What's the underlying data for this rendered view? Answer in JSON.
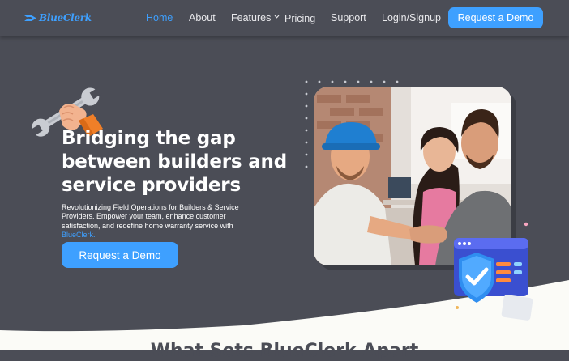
{
  "nav": {
    "logo_text": "BlueClerk",
    "links": [
      "Home",
      "About",
      "Features",
      "Pricing",
      "Support",
      "Login/Signup"
    ],
    "active": "Home",
    "cta": "Request a Demo"
  },
  "hero": {
    "title_lines": [
      "Bridging the gap",
      "between builders and",
      "service providers"
    ],
    "description": "Revolutionizing Field Operations for Builders & Service Providers. Empower your team, enhance customer satisfaction, and redefine home warranty service with",
    "description_brand": "BlueClerk.",
    "cta": "Request a Demo"
  },
  "section": {
    "title": "What Sets BlueClerk Apart"
  },
  "colors": {
    "background": "#4b4d56",
    "accent": "#3ea0ff",
    "light_section": "#fbfbf7"
  },
  "icons": [
    "wrench-hand-icon",
    "shield-check-icon",
    "chevron-down-icon",
    "logo-mark-icon"
  ]
}
